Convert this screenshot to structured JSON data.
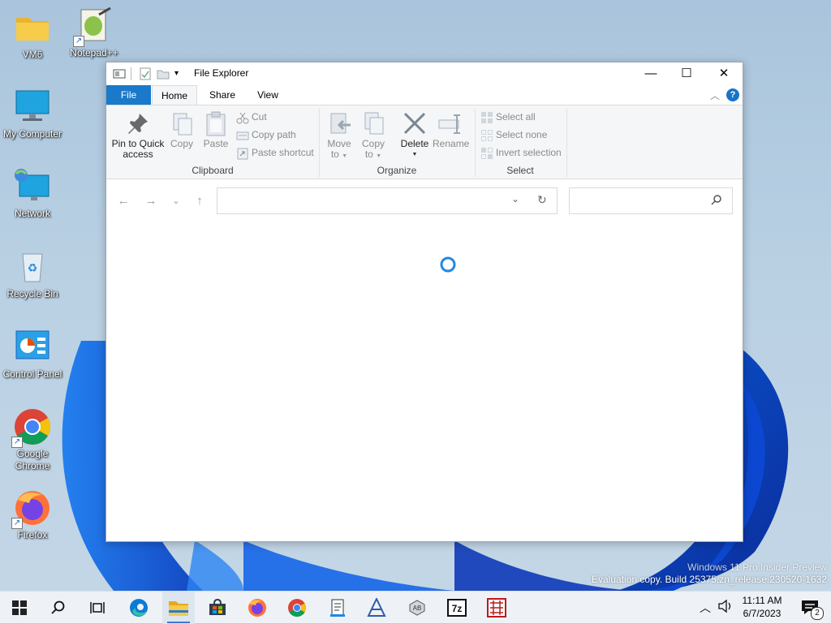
{
  "desktop": {
    "icons": [
      {
        "label": "VM6"
      },
      {
        "label": "Notepad++"
      },
      {
        "label": "My Computer"
      },
      {
        "label": "Network"
      },
      {
        "label": "Recycle Bin"
      },
      {
        "label": "Control Panel"
      },
      {
        "label": "Google Chrome"
      },
      {
        "label": "Firefox"
      }
    ],
    "watermark": {
      "line1": "Windows 11 Pro Insider Preview",
      "line2": "Evaluation copy. Build 25375.zn_release.230520-1632"
    }
  },
  "explorer": {
    "title": "File Explorer",
    "tabs": {
      "file": "File",
      "home": "Home",
      "share": "Share",
      "view": "View"
    },
    "clipboard": {
      "pin_line1": "Pin to Quick",
      "pin_line2": "access",
      "copy": "Copy",
      "paste": "Paste",
      "cut": "Cut",
      "copy_path": "Copy path",
      "paste_shortcut": "Paste shortcut",
      "group": "Clipboard"
    },
    "organize": {
      "move_line1": "Move",
      "move_line2": "to",
      "copy_line1": "Copy",
      "copy_line2": "to",
      "delete": "Delete",
      "rename": "Rename",
      "group": "Organize"
    },
    "select": {
      "select_all": "Select all",
      "select_none": "Select none",
      "invert": "Invert selection",
      "group": "Select"
    },
    "address": {
      "value": ""
    },
    "search": {
      "value": ""
    }
  },
  "taskbar": {
    "time": "11:11 AM",
    "date": "6/7/2023",
    "notification_count": "2",
    "accent": "#3a7bd5"
  }
}
